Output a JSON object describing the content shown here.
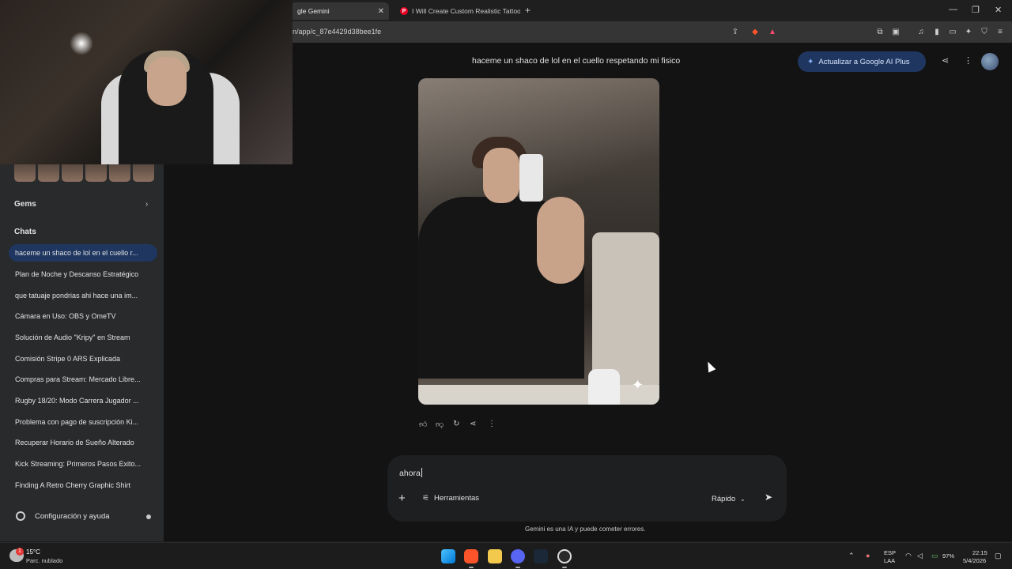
{
  "browser": {
    "active_tab": "gle Gemini",
    "inactive_tab": "I Will Create Custom Realistic Tattoo",
    "url": "n/app/c_87e4429d38bee1fe"
  },
  "sidebar": {
    "gems_label": "Gems",
    "chats_label": "Chats",
    "chats": [
      "haceme un shaco de lol en el cuello r...",
      "Plan de Noche y Descanso Estratégico",
      "que tatuaje pondrias ahi hace una im...",
      "Cámara en Uso: OBS y OmeTV",
      "Solución de Audio \"Kripy\" en Stream",
      "Comisión Stripe 0 ARS Explicada",
      "Compras para Stream: Mercado Libre...",
      "Rugby 18/20: Modo Carrera Jugador ...",
      "Problema con pago de suscripción Ki...",
      "Recuperar Horario de Sueño Alterado",
      "Kick Streaming: Primeros Pasos Exito...",
      "Finding A Retro Cherry Graphic Shirt"
    ],
    "settings_label": "Configuración y ayuda"
  },
  "main": {
    "conversation_title": "haceme un shaco de lol en el cuello respetando mi fisico",
    "upgrade_label": "Actualizar a Google AI Plus"
  },
  "composer": {
    "input_value": "ahora",
    "tools_label": "Herramientas",
    "model_label": "Rápido",
    "disclaimer": "Gemini es una IA y puede cometer errores."
  },
  "taskbar": {
    "weather_temp": "15°C",
    "weather_desc": "Parc. nublado",
    "weather_badge": "1",
    "lang_line1": "ESP",
    "lang_line2": "LAA",
    "battery": "97%",
    "time": "22:15",
    "date": "5/4/2026"
  }
}
